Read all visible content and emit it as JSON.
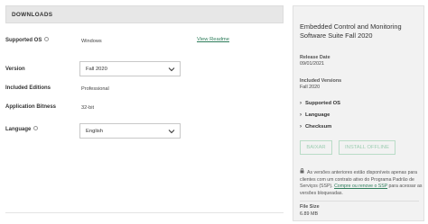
{
  "downloads": {
    "header": "DOWNLOADS",
    "supported_os": {
      "label": "Supported OS",
      "value": "Windows",
      "link": "View Readme"
    },
    "version": {
      "label": "Version",
      "value": "Fall 2020"
    },
    "included_editions": {
      "label": "Included Editions",
      "value": "Professional"
    },
    "application_bitness": {
      "label": "Application Bitness",
      "value": "32-bit"
    },
    "language": {
      "label": "Language",
      "value": "English"
    }
  },
  "details": {
    "title": "Embedded Control and Monitoring Software Suite Fall 2020",
    "release_date_label": "Release Date",
    "release_date": "09/01/2021",
    "included_versions_label": "Included Versions",
    "included_versions": "Fall 2020",
    "expanders": [
      "Supported OS",
      "Language",
      "Checksum"
    ],
    "download_button": "BAIXAR",
    "install_button": "INSTALL OFFLINE",
    "note_text": "As versões anteriores estão disponíveis apenas para clientes com um contrato ativo do Programa Padrão de Serviços (SSP). ",
    "note_link": "Compre ou renove o SSP",
    "note_suffix": " para acessar as versões bloqueadas.",
    "file_size_label": "File Size",
    "file_size": "6.89 MB"
  },
  "colors": {
    "accent": "#2e7d5b",
    "button_border": "#b9dcc7",
    "panel_bg": "#f2f2f2"
  },
  "icons": [
    "info-icon",
    "chevron-down-icon",
    "chevron-right-icon",
    "lock-icon"
  ]
}
